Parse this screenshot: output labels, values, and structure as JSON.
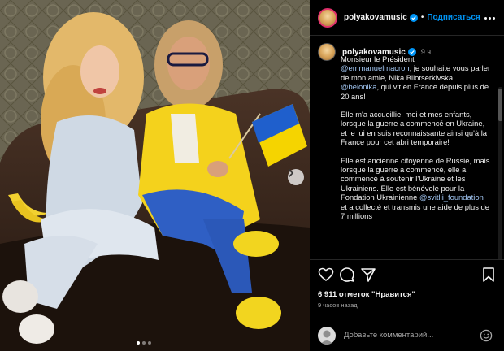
{
  "header": {
    "username": "polyakovamusic",
    "follow_label": "Подписаться",
    "dot": "•"
  },
  "caption": {
    "username": "polyakovamusic",
    "time": "9 ч.",
    "p1_a": "Monsieur le Président",
    "p1_mention1": "@emmanuelmacron",
    "p1_b": ", je souhaite vous parler de mon amie, Nika Bilotserkivska",
    "p1_mention2": "@belonika",
    "p1_c": ", qui vit en France depuis plus de 20 ans!",
    "p2": "Elle m'a accueillie, moi et mes enfants, lorsque la guerre a commencé en Ukraine, et je lui en suis reconnaissante ainsi qu'à la France pour cet abri temporaire!",
    "p3_a": "Elle est ancienne citoyenne de Russie, mais lorsque la guerre a commencé, elle a commencé à soutenir l'Ukraine et les Ukrainiens. Elle est bénévole pour la Fondation Ukrainienne",
    "p3_mention": "@svitlii_foundation",
    "p3_b": " et a collecté et transmis une aide de plus de 7 millions"
  },
  "stats": {
    "likes": "6 911 отметок \"Нравится\"",
    "ago": "9 часов назад"
  },
  "comment": {
    "placeholder": "Добавьте комментарий..."
  },
  "icons": {
    "verified": "verified-badge-icon",
    "like": "heart-icon",
    "comment": "comment-icon",
    "share": "paper-plane-icon",
    "save": "bookmark-icon",
    "emoji": "smiley-icon",
    "next": "chevron-right-icon",
    "more": "more-options-icon"
  },
  "colors": {
    "accent": "#0095f6",
    "background": "#000000",
    "flag_blue": "#1f5fcc",
    "flag_yellow": "#f5d400"
  }
}
